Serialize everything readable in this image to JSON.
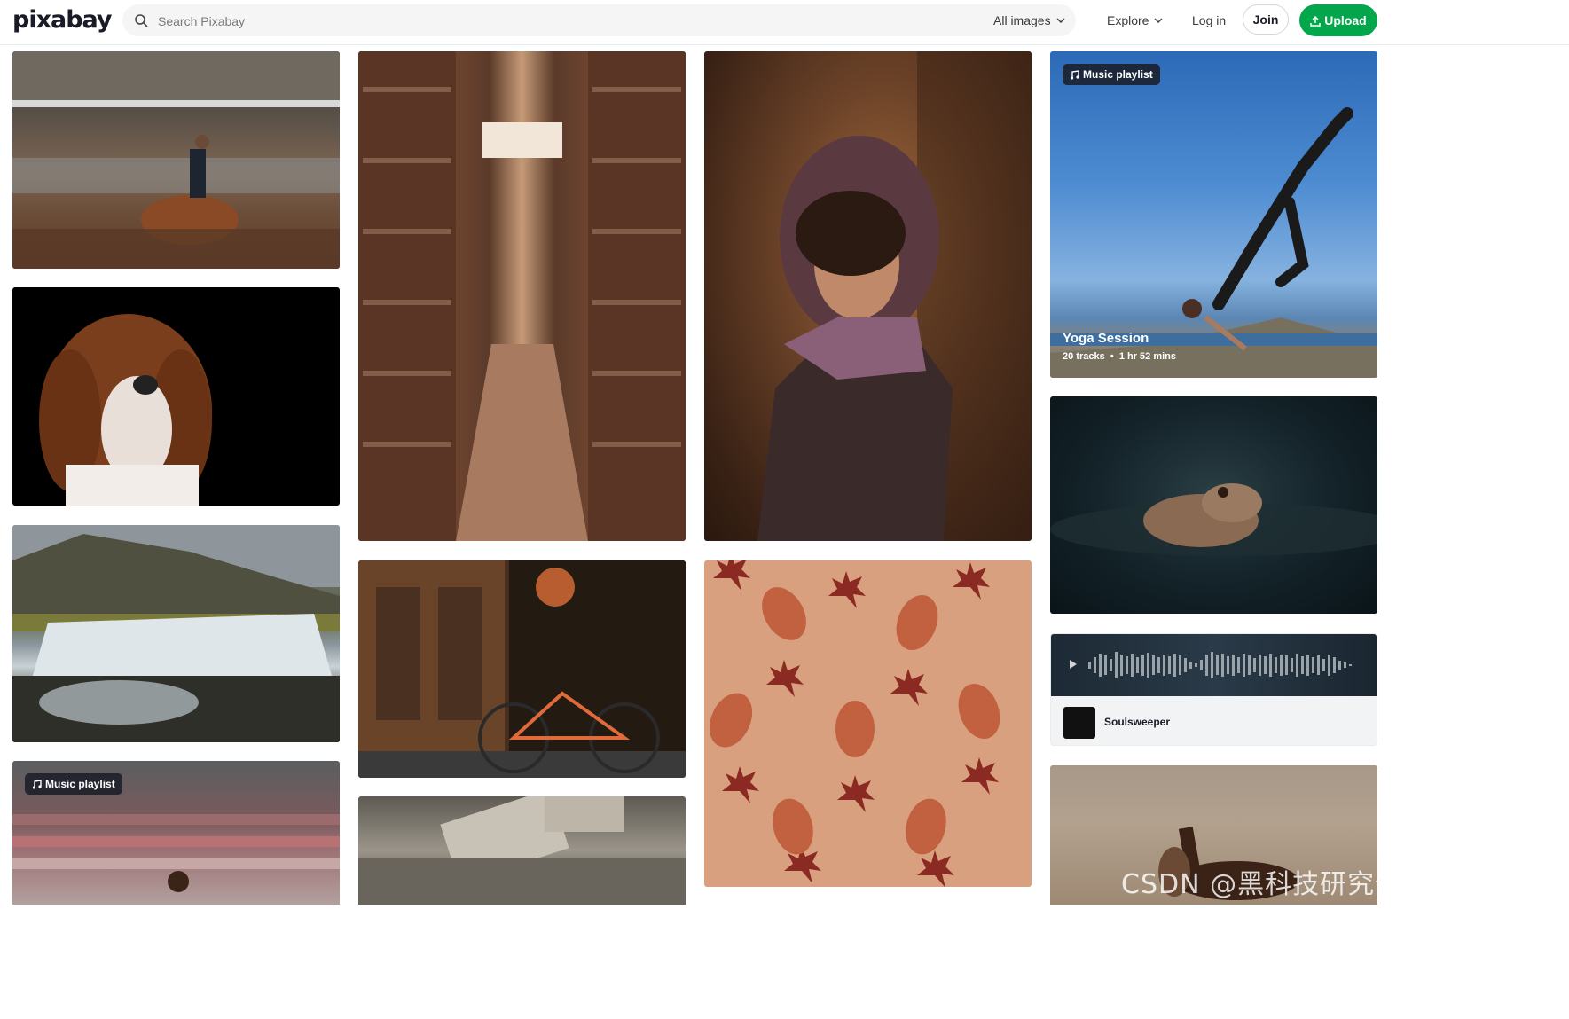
{
  "header": {
    "logo": "pixabay",
    "search_placeholder": "Search Pixabay",
    "filter_label": "All images",
    "explore_label": "Explore",
    "login_label": "Log in",
    "join_label": "Join",
    "upload_label": "Upload"
  },
  "tiles": {
    "playlist_badge": "Music playlist",
    "yoga_title": "Yoga Session",
    "yoga_tracks": "20 tracks",
    "yoga_duration": "1 hr 52 mins",
    "audio_name": "Soulsweeper",
    "stadium_badge": "Music playlist"
  },
  "watermark": "CSDN @黑科技研究僧",
  "colors": {
    "brand_green": "#03a64a",
    "text_dark": "#191b26",
    "search_bg": "#f5f5f5"
  }
}
